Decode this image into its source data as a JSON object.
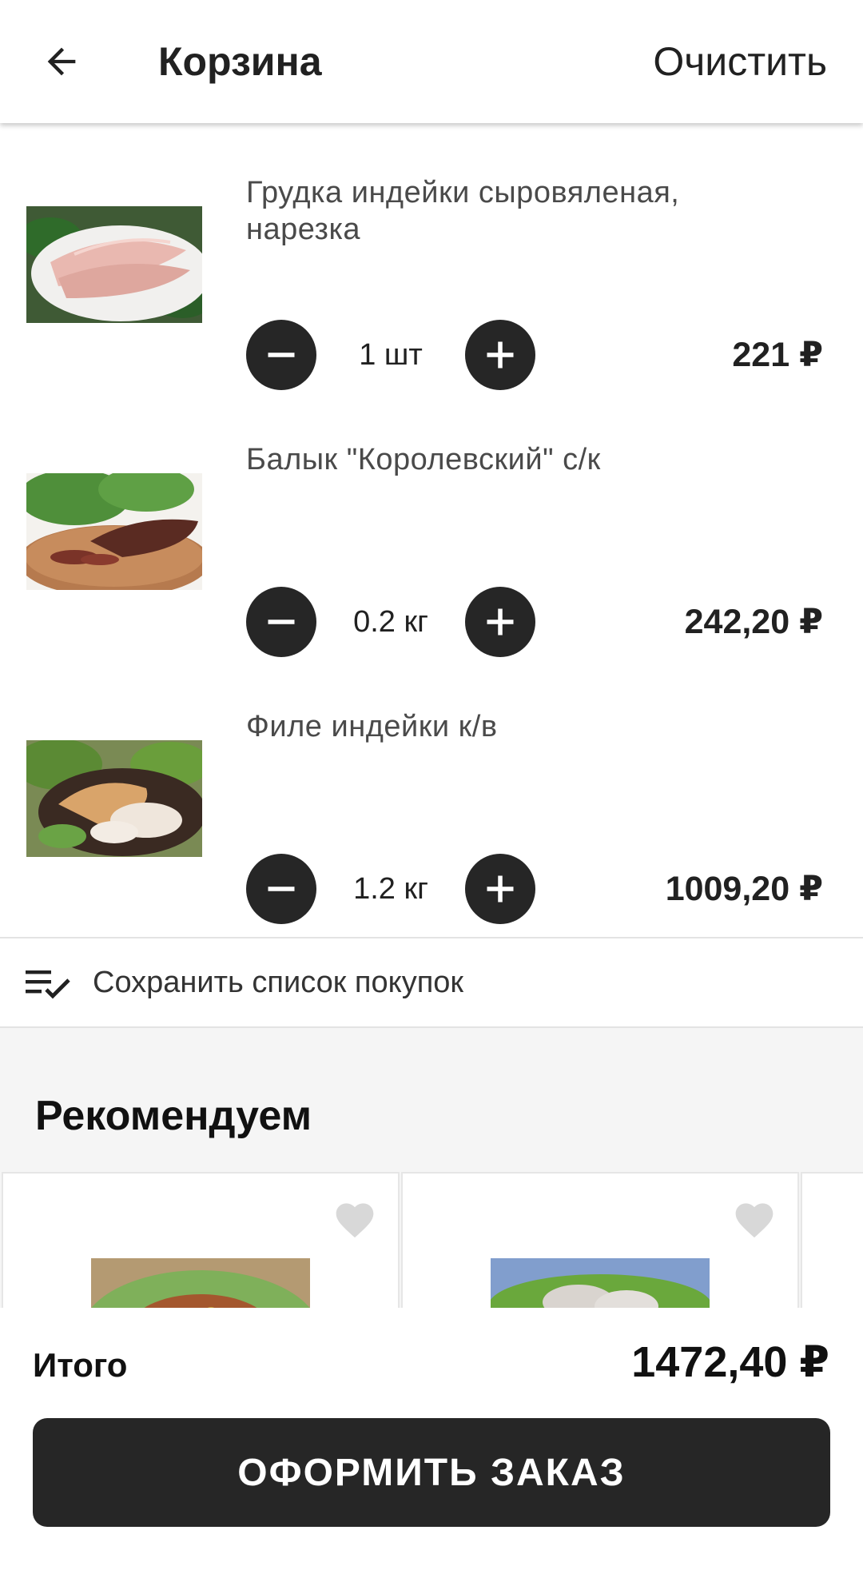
{
  "header": {
    "title": "Корзина",
    "clear_label": "Очистить",
    "back_icon": "arrow-left-icon"
  },
  "cart_items": [
    {
      "name": "Грудка индейки сыровяленая, нарезка",
      "quantity": "1 шт",
      "price": "221 ₽"
    },
    {
      "name": "Балык \"Королевский\" с/к",
      "quantity": "0.2 кг",
      "price": "242,20 ₽"
    },
    {
      "name": "Филе индейки к/в",
      "quantity": "1.2 кг",
      "price": "1009,20 ₽"
    }
  ],
  "save_list": {
    "label": "Сохранить список покупок",
    "icon": "playlist-check-icon"
  },
  "recommend": {
    "title": "Рекомендуем"
  },
  "footer": {
    "total_label": "Итого",
    "total_value": "1472,40 ₽",
    "checkout_label": "ОФОРМИТЬ ЗАКАЗ"
  },
  "colors": {
    "dark": "#262626",
    "divider": "#e3e3e3",
    "section_bg": "#f5f5f5",
    "heart": "#d8d8d8"
  }
}
